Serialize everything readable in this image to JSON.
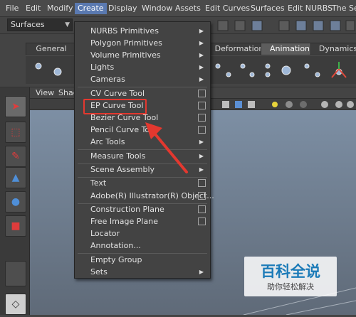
{
  "menubar": {
    "items": [
      "File",
      "Edit",
      "Modify",
      "Create",
      "Display",
      "Window",
      "Assets",
      "Edit Curves",
      "Surfaces",
      "Edit NURBS",
      "The Set"
    ]
  },
  "status": {
    "mode": "Surfaces"
  },
  "shelf": {
    "tabs": [
      "General",
      "Deformation",
      "Animation",
      "Dynamics"
    ]
  },
  "panel": {
    "menus": [
      "View",
      "Shad"
    ]
  },
  "create_menu": {
    "items": [
      {
        "label": "NURBS Primitives",
        "submenu": true
      },
      {
        "label": "Polygon Primitives",
        "submenu": true
      },
      {
        "label": "Volume Primitives",
        "submenu": true
      },
      {
        "label": "Lights",
        "submenu": true
      },
      {
        "label": "Cameras",
        "submenu": true
      },
      {
        "label": "CV Curve Tool",
        "option_box": true
      },
      {
        "label": "EP Curve Tool",
        "option_box": true
      },
      {
        "label": "Bezier Curve Tool",
        "option_box": true
      },
      {
        "label": "Pencil Curve Tool",
        "option_box": true
      },
      {
        "label": "Arc Tools",
        "submenu": true
      },
      {
        "label": "Measure Tools",
        "submenu": true
      },
      {
        "label": "Scene Assembly",
        "submenu": true
      },
      {
        "label": "Text",
        "option_box": true
      },
      {
        "label": "Adobe(R) Illustrator(R) Object...",
        "option_box": true
      },
      {
        "label": "Construction Plane",
        "option_box": true
      },
      {
        "label": "Free Image Plane",
        "option_box": true
      },
      {
        "label": "Locator"
      },
      {
        "label": "Annotation..."
      },
      {
        "label": "Empty Group"
      },
      {
        "label": "Sets",
        "submenu": true
      }
    ]
  },
  "watermark": {
    "main": "百科全说",
    "sub": "助你轻松解决"
  },
  "colors": {
    "menu_active": "#5a79b0",
    "highlight": "#e3382f",
    "watermark_blue": "#1c7bb8"
  },
  "icons": [
    "select-tool-icon",
    "lasso-tool-icon",
    "paint-tool-icon",
    "move-tool-icon",
    "rotate-tool-icon",
    "scale-tool-icon",
    "grid-icon",
    "arrow-annotation-icon"
  ]
}
